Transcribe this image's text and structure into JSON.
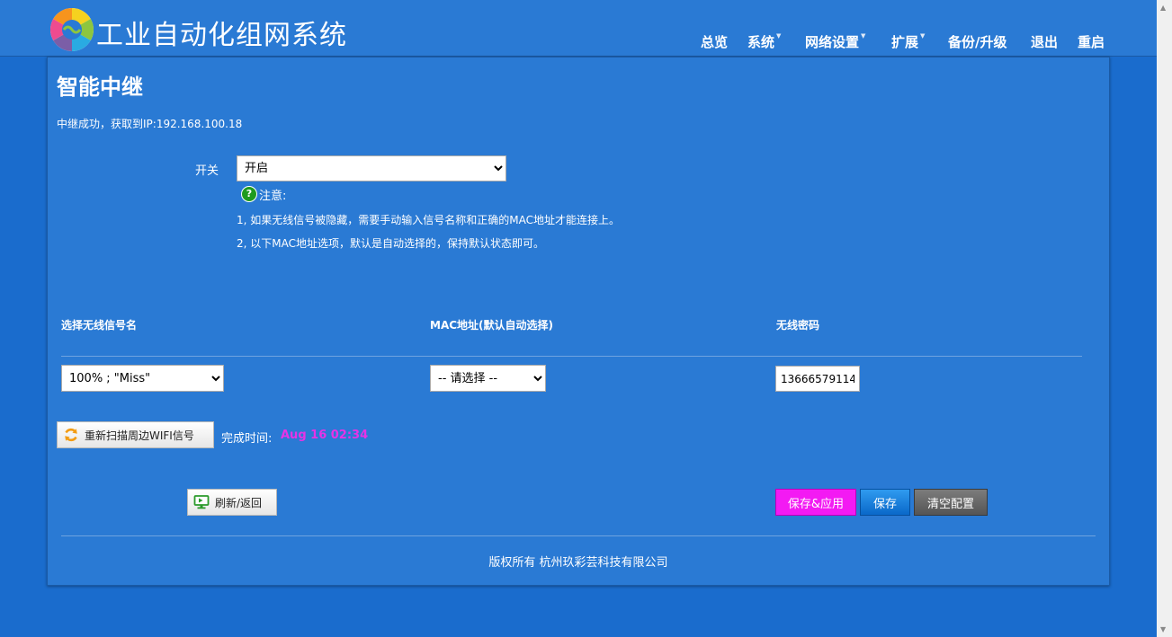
{
  "header": {
    "brand": "工业自动化组网系统",
    "nav": [
      {
        "label": "总览",
        "dropdown": false
      },
      {
        "label": "系统",
        "dropdown": true
      },
      {
        "label": "网络设置",
        "dropdown": true
      },
      {
        "label": "扩展",
        "dropdown": true
      },
      {
        "label": "备份/升级",
        "dropdown": false
      },
      {
        "label": "退出",
        "dropdown": false
      },
      {
        "label": "重启",
        "dropdown": false
      }
    ]
  },
  "page": {
    "title": "智能中继",
    "status": "中继成功，获取到IP:192.168.100.18"
  },
  "form": {
    "switch_label": "开关",
    "switch_value": "开启",
    "note_icon": "question-icon",
    "note_title": "注意:",
    "note_lines": [
      "1, 如果无线信号被隐藏，需要手动输入信号名称和正确的MAC地址才能连接上。",
      "2, 以下MAC地址选项，默认是自动选择的，保持默认状态即可。"
    ],
    "columns": {
      "ssid": "选择无线信号名",
      "mac": "MAC地址(默认自动选择)",
      "password": "无线密码"
    },
    "ssid_value": "100% ; \"Miss\"",
    "mac_value": "-- 请选择 --",
    "password_value": "13666579114",
    "rescan_label": "重新扫描周边WIFI信号",
    "finish_time_label": "完成时间:",
    "finish_time_value": "Aug 16 02:34"
  },
  "buttons": {
    "refresh": "刷新/返回",
    "save_apply": "保存&应用",
    "save": "保存",
    "clear": "清空配置"
  },
  "footer": {
    "copyright": "版权所有 杭州玖彩芸科技有限公司"
  },
  "colors": {
    "background": "#1a6ccd",
    "panel": "#2a7ad4",
    "save_apply": "#f31af3",
    "save": "#0a79d8",
    "clear": "#666666",
    "time_value": "#e633e6"
  }
}
